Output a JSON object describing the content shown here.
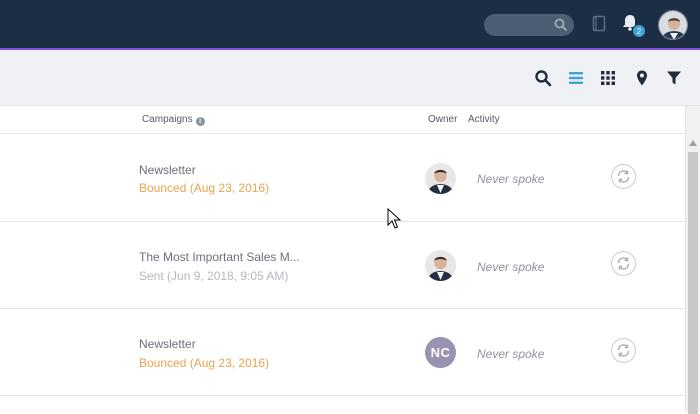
{
  "topbar": {
    "search": {
      "placeholder": "",
      "icon": "search-icon"
    },
    "notifications": {
      "icon": "bell-icon",
      "badge_count": "2"
    },
    "book_icon": "book-icon",
    "user_avatar": "avatar"
  },
  "toolbar": {
    "icons": [
      "search-icon",
      "list-view-icon",
      "grid-view-icon",
      "map-pin-icon",
      "filter-icon"
    ],
    "active_icon": "list-view-icon",
    "accent_color": "#3ea3d6"
  },
  "table": {
    "headers": {
      "campaigns": "Campaigns",
      "owner": "Owner",
      "activity": "Activity"
    },
    "rows": [
      {
        "campaign": "Newsletter",
        "status": "Bounced (Aug 23, 2016)",
        "status_type": "bounced",
        "owner_type": "photo",
        "owner_initials": "",
        "activity": "Never spoke"
      },
      {
        "campaign": "The Most Important Sales M...",
        "status": "Sent (Jun 9, 2018, 9:05 AM)",
        "status_type": "sent",
        "owner_type": "photo",
        "owner_initials": "",
        "activity": "Never spoke"
      },
      {
        "campaign": "Newsletter",
        "status": "Bounced (Aug 23, 2016)",
        "status_type": "bounced",
        "owner_type": "initials",
        "owner_initials": "NC",
        "activity": "Never spoke"
      }
    ]
  },
  "colors": {
    "topbar": "#1b2e44",
    "accent_purple": "#8a4bd6",
    "bounced": "#e8a44f",
    "sent": "#b4b8be",
    "initials_bg": "#9a92b1"
  }
}
